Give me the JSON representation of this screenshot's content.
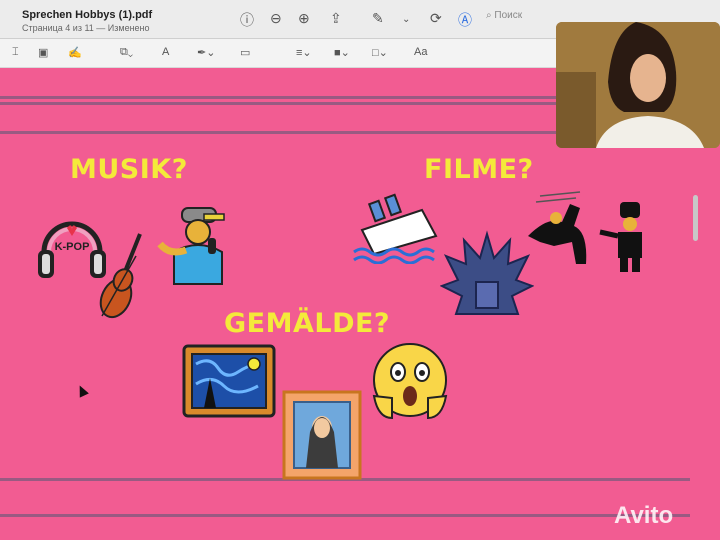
{
  "window": {
    "title": "Sprechen Hobbys  (1).pdf",
    "subtitle": "Страница 4 из 11 — Изменено",
    "search_placeholder": "Поиск"
  },
  "toolbar": {
    "icons": [
      "info-icon",
      "zoom-out-icon",
      "zoom-in-icon",
      "share-icon",
      "markup-pen-icon",
      "rotate-icon",
      "highlight-icon",
      "search-icon"
    ]
  },
  "markup_bar": {
    "icons": [
      "text-selection-icon",
      "rectangle-selection-icon",
      "sketch-icon",
      "shapes-icon",
      "text-box-icon",
      "sign-icon",
      "note-icon",
      "line-style-icon",
      "border-color-icon",
      "fill-color-icon"
    ],
    "font_label": "Aa"
  },
  "slide": {
    "heading_music": "MUSIK?",
    "heading_films": "FILME?",
    "heading_paintings": "GEMÄLDE?",
    "kpop_label": "K-POP"
  },
  "watermark": "Avito",
  "colors": {
    "background": "#f25c92",
    "heading": "#f4ea3a"
  }
}
